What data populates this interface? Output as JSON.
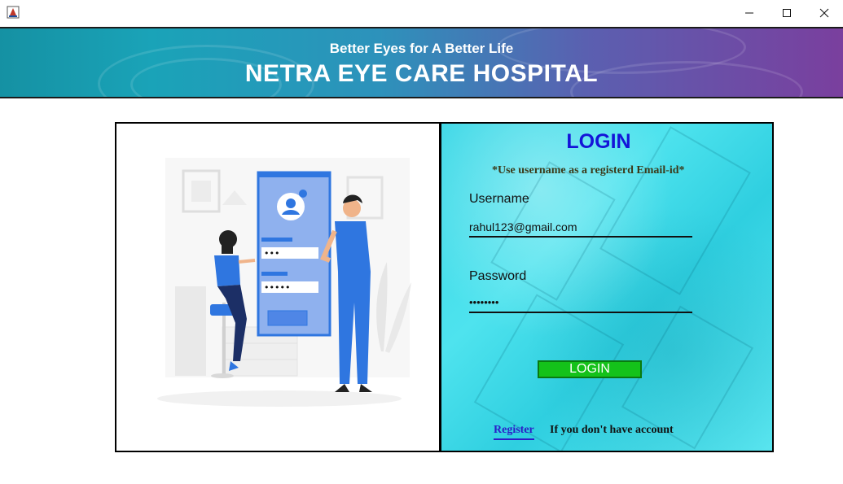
{
  "window": {
    "icon": "java-app-icon",
    "controls": {
      "minimize": "minimize-icon",
      "maximize": "maximize-icon",
      "close": "close-icon"
    }
  },
  "banner": {
    "tagline": "Better Eyes for A Better Life",
    "hospital_name": "NETRA EYE CARE HOSPITAL",
    "colors": {
      "start": "#1591a3",
      "end": "#7a3f9e"
    }
  },
  "illustration": {
    "name": "login-illustration",
    "password_dots_1": "•••",
    "password_dots_2": "•••••"
  },
  "login": {
    "title": "LOGIN",
    "hint": "*Use username as a registerd  Email-id*",
    "username_label": "Username",
    "username_value": "rahul123@gmail.com",
    "password_label": "Password",
    "password_value": "••••••••",
    "button_label": "LOGIN",
    "register_link": "Register",
    "register_note": "If you don't have account",
    "colors": {
      "title": "#1414d8",
      "button": "#14c21a",
      "link": "#2b1ec8",
      "panel": "#39d7e6"
    }
  }
}
